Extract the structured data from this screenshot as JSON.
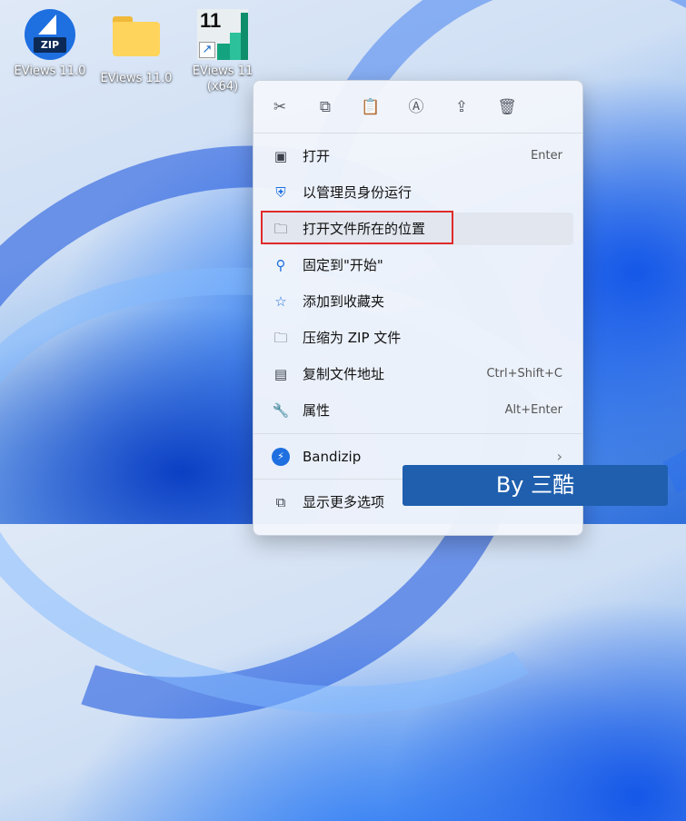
{
  "desktop": {
    "icons": [
      {
        "label": "EViews 11.0",
        "icon": "bandizip-zip-icon"
      },
      {
        "label": "EViews 11.0",
        "icon": "folder-icon"
      },
      {
        "label": "EViews 11\n(x64)",
        "icon": "eviews-app-icon",
        "badge_number": "11"
      }
    ]
  },
  "context_menu": {
    "toolbar": [
      {
        "name": "cut",
        "icon": "scissors-icon"
      },
      {
        "name": "copy",
        "icon": "copy-icon"
      },
      {
        "name": "paste",
        "icon": "clipboard-icon"
      },
      {
        "name": "rename",
        "icon": "rename-icon"
      },
      {
        "name": "share",
        "icon": "share-icon"
      },
      {
        "name": "delete",
        "icon": "trash-icon"
      }
    ],
    "items": [
      {
        "label": "打开",
        "shortcut": "Enter",
        "icon": "window-icon"
      },
      {
        "label": "以管理员身份运行",
        "shortcut": "",
        "icon": "shield-icon"
      },
      {
        "label": "打开文件所在的位置",
        "shortcut": "",
        "icon": "folder-icon",
        "highlighted": true
      },
      {
        "label": "固定到\"开始\"",
        "shortcut": "",
        "icon": "pin-icon"
      },
      {
        "label": "添加到收藏夹",
        "shortcut": "",
        "icon": "star-icon"
      },
      {
        "label": "压缩为 ZIP 文件",
        "shortcut": "",
        "icon": "zip-folder-icon"
      },
      {
        "label": "复制文件地址",
        "shortcut": "Ctrl+Shift+C",
        "icon": "path-icon"
      },
      {
        "label": "属性",
        "shortcut": "Alt+Enter",
        "icon": "wrench-icon"
      }
    ],
    "bandizip": {
      "label": "Bandizip",
      "icon": "bandizip-icon",
      "arrow": "›"
    },
    "more": {
      "label": "显示更多选项",
      "icon": "more-options-icon"
    }
  },
  "watermark": {
    "text": "By 三酷"
  },
  "colors": {
    "highlight_border": "#e02b2b",
    "banner": "#1f5fae",
    "accent": "#1e6fe0"
  }
}
